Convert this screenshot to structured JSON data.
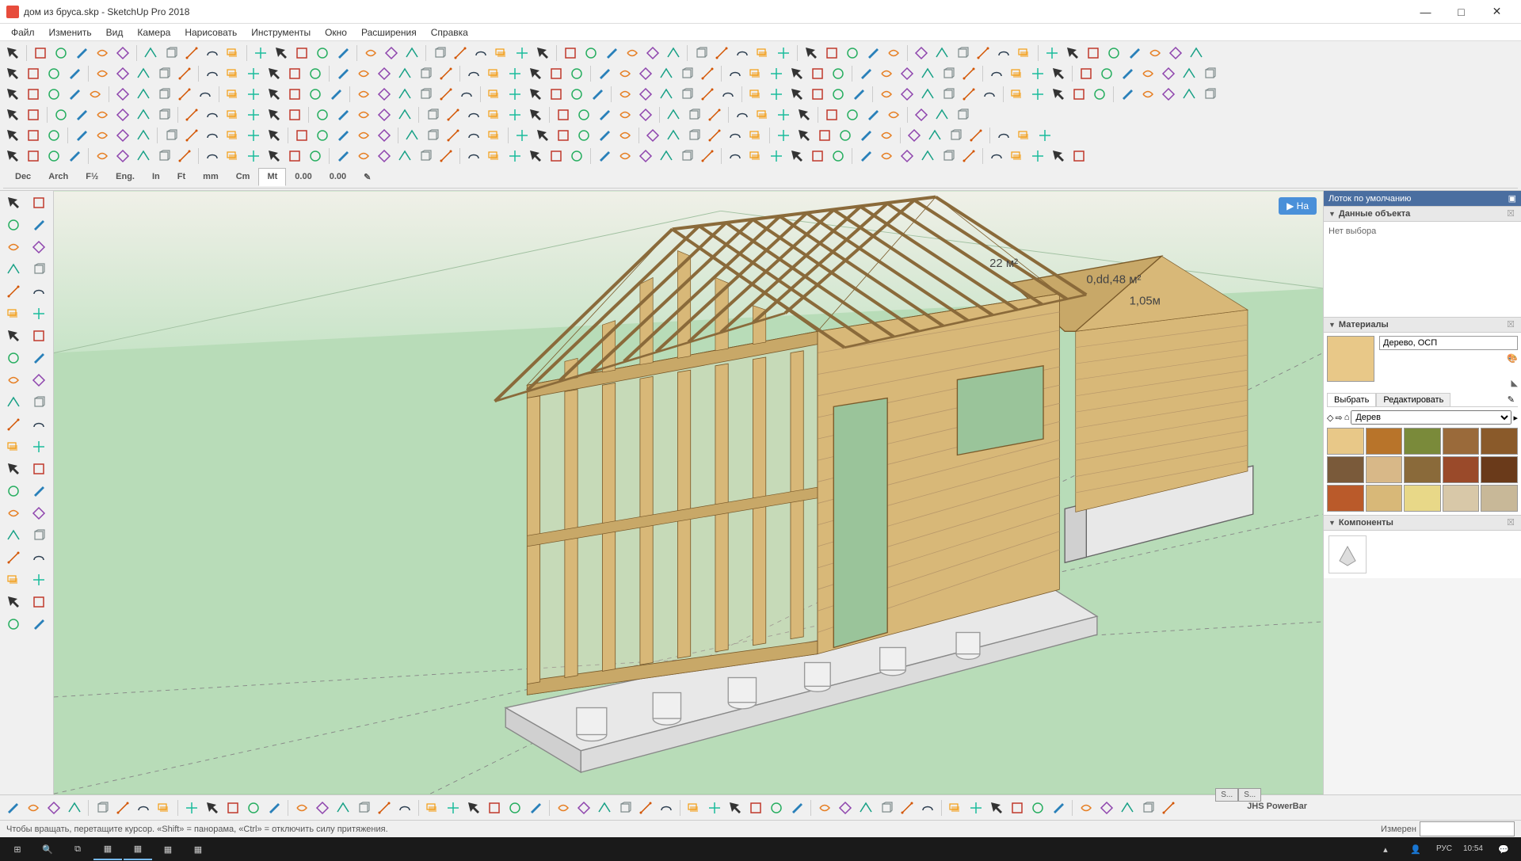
{
  "title": "дом из бруса.skp - SketchUp Pro 2018",
  "menu": [
    "Файл",
    "Изменить",
    "Вид",
    "Камера",
    "Нарисовать",
    "Инструменты",
    "Окно",
    "Расширения",
    "Справка"
  ],
  "unit_tabs": [
    "Dec",
    "Arch",
    "F½",
    "Eng.",
    "In",
    "Ft",
    "mm",
    "Cm",
    "Mt",
    "0.00",
    "0.00"
  ],
  "unit_active": "Mt",
  "tray": {
    "title": "Лоток по умолчанию",
    "panels": {
      "entity": {
        "title": "Данные объекта",
        "message": "Нет выбора"
      },
      "materials": {
        "title": "Материалы",
        "current_name": "Дерево, ОСП",
        "tab_select": "Выбрать",
        "tab_edit": "Редактировать",
        "dropdown": "Дерев",
        "swatches": [
          "#e8c888",
          "#b8742a",
          "#7a8a3a",
          "#9a6a3a",
          "#8a5a2a",
          "#7a5a3a",
          "#d8b888",
          "#8a6a3a",
          "#9a4a2a",
          "#6a3a1a",
          "#ba5a2a",
          "#d8b878",
          "#e8d888",
          "#d8c8a8",
          "#c8b898"
        ]
      },
      "components": {
        "title": "Компоненты"
      }
    }
  },
  "annotations": {
    "area1": "22 м²",
    "area2": "0,dd,48 м²",
    "dim1": "1,05м"
  },
  "viewport_hint": "На",
  "statusbar": {
    "hint": "Чтобы вращать, перетащите курсор. «Shift» = панорама, «Ctrl» = отключить силу притяжения.",
    "measure_label": "Измерен",
    "powerbar": "JHS PowerBar",
    "mini_tabs": [
      "S...",
      "S..."
    ]
  },
  "taskbar": {
    "lang": "РУС",
    "time": "10:54"
  },
  "icon_colors": [
    "#333",
    "#c0392b",
    "#27ae60",
    "#2980b9",
    "#e67e22",
    "#8e44ad",
    "#16a085",
    "#7f8c8d",
    "#d35400",
    "#2c3e50",
    "#f39c12",
    "#1abc9c"
  ]
}
